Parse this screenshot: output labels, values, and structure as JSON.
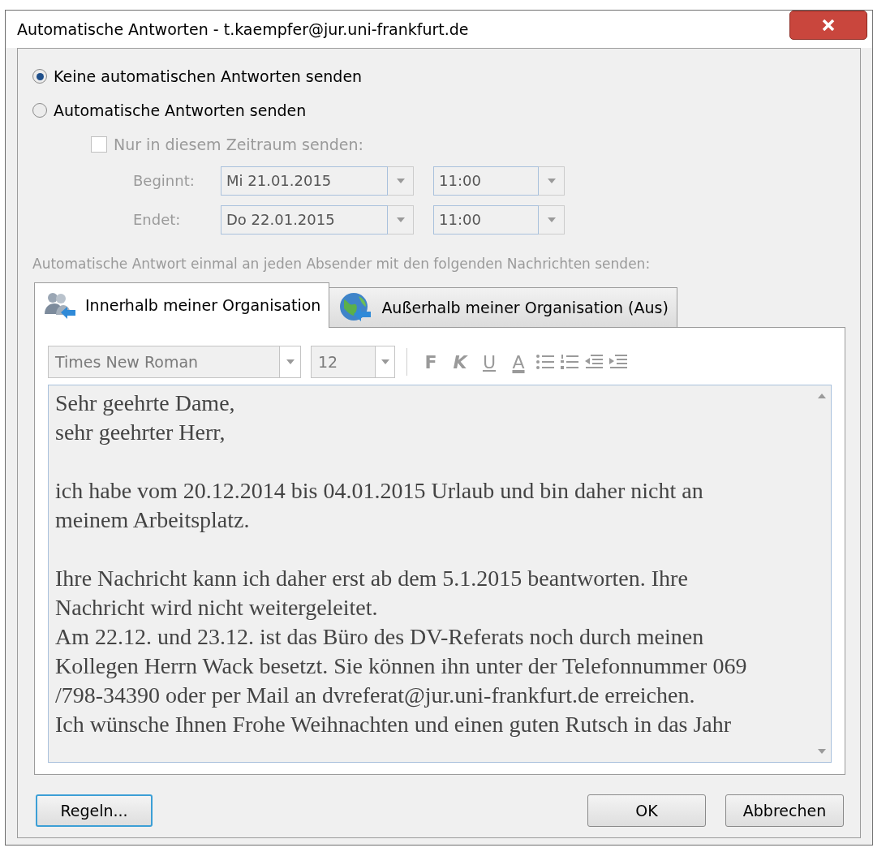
{
  "window": {
    "title": "Automatische Antworten - t.kaempfer@jur.uni-frankfurt.de"
  },
  "radios": [
    {
      "label": "Keine automatischen Antworten senden",
      "selected": true
    },
    {
      "label": "Automatische Antworten senden",
      "selected": false
    }
  ],
  "period": {
    "label": "Nur in diesem Zeitraum senden:",
    "checked": false,
    "disabled": true,
    "rows": [
      {
        "label": "Beginnt:",
        "date": "Mi 21.01.2015",
        "time": "11:00"
      },
      {
        "label": "Endet:",
        "date": "Do 22.01.2015",
        "time": "11:00"
      }
    ]
  },
  "hint": "Automatische Antwort einmal an jeden Absender mit den folgenden Nachrichten senden:",
  "tabs": [
    {
      "label": "Innerhalb meiner Organisation",
      "selected": true,
      "kind": "people"
    },
    {
      "label": "Außerhalb meiner Organisation (Aus)",
      "selected": false,
      "kind": "globe"
    }
  ],
  "toolbar": {
    "font": "Times New Roman",
    "size": "12",
    "buttons": [
      {
        "kind": "text",
        "label": "F"
      },
      {
        "kind": "text",
        "label": "K"
      },
      {
        "kind": "text",
        "label": "U"
      },
      {
        "kind": "text",
        "label": "A"
      },
      {
        "kind": "bullets"
      },
      {
        "kind": "numbers"
      },
      {
        "kind": "outdent"
      },
      {
        "kind": "indent"
      }
    ]
  },
  "body": [
    {
      "lines": [
        "Sehr geehrte Dame,",
        "sehr geehrter Herr,"
      ]
    },
    {
      "lines": [
        "ich habe vom 20.12.2014 bis 04.01.2015 Urlaub und bin daher nicht an",
        "meinem Arbeitsplatz."
      ]
    },
    {
      "lines": [
        "Ihre Nachricht kann ich daher erst ab dem 5.1.2015 beantworten. Ihre",
        "Nachricht wird nicht weitergeleitet.",
        "Am 22.12. und 23.12. ist das Büro des DV-Referats noch durch meinen",
        "Kollegen Herrn Wack besetzt. Sie können ihn unter der Telefonnummer 069",
        "/798-34390 oder per Mail an dvreferat@jur.uni-frankfurt.de erreichen.",
        "Ich wünsche Ihnen Frohe Weihnachten und einen guten Rutsch in das Jahr"
      ]
    }
  ],
  "buttons": {
    "rules": "Regeln...",
    "ok": "OK",
    "cancel": "Abbrechen"
  }
}
